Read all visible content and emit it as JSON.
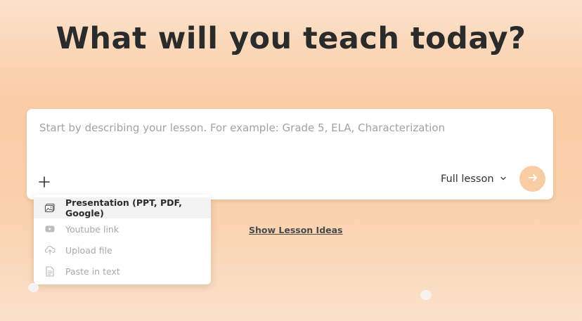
{
  "headline": "What will you teach today?",
  "prompt": {
    "placeholder": "Start by describing your lesson. For example: Grade 5, ELA, Characterization",
    "value": ""
  },
  "mode_select": {
    "selected": "Full lesson",
    "icon": "chevron-down-icon"
  },
  "attach_menu": {
    "items": [
      {
        "label": "Presentation (PPT, PDF, Google)",
        "icon": "image-icon",
        "state": "active"
      },
      {
        "label": "Youtube link",
        "icon": "youtube-icon",
        "state": "disabled"
      },
      {
        "label": "Upload file",
        "icon": "upload-cloud-icon",
        "state": "disabled"
      },
      {
        "label": "Paste in text",
        "icon": "document-icon",
        "state": "disabled"
      }
    ]
  },
  "show_ideas_link": "Show Lesson Ideas",
  "colors": {
    "accent": "#f8cda4",
    "text_dark": "#2b2b2b",
    "muted": "#a8a8a8"
  }
}
